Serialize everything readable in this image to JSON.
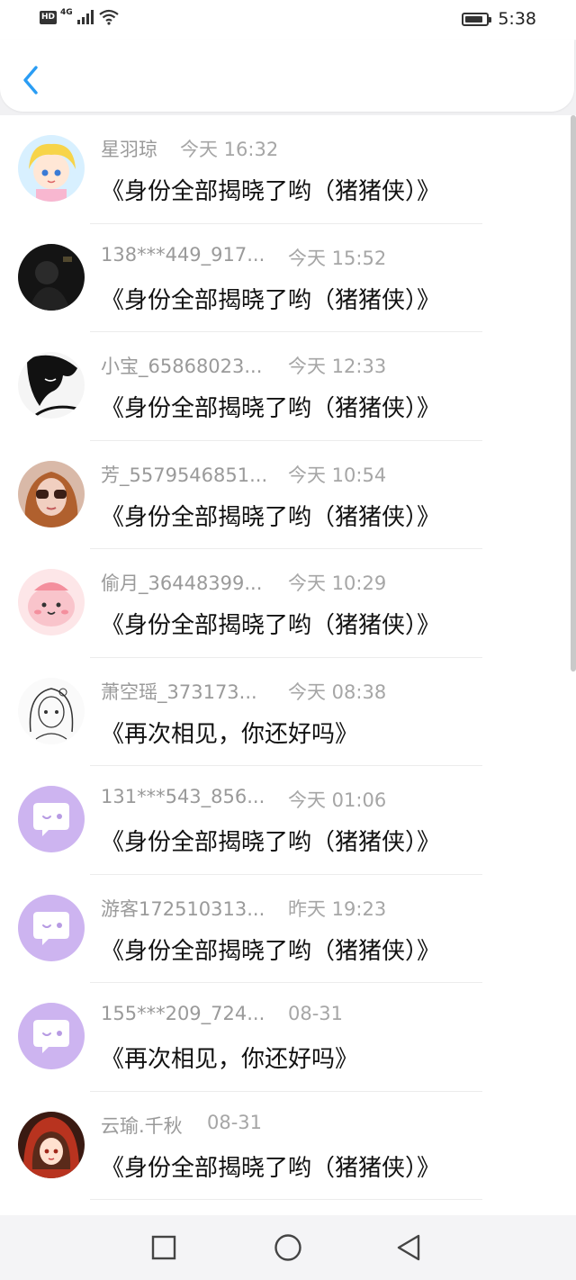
{
  "status_bar": {
    "network_badge": "HD",
    "signal_label": "4G",
    "time": "5:38",
    "battery_level": 0.85
  },
  "header": {
    "back_icon": "chevron-left-icon",
    "accent": "#2a9df4"
  },
  "messages": [
    {
      "name": "星羽琼",
      "time": "今天 16:32",
      "text": "《身份全部揭晓了哟（猪猪侠）》",
      "avatar": "anime-girl-blonde"
    },
    {
      "name": "138***449_917...",
      "time": "今天 15:52",
      "text": "《身份全部揭晓了哟（猪猪侠）》",
      "avatar": "dark-photo"
    },
    {
      "name": "小宝_65868023...",
      "time": "今天 12:33",
      "text": "《身份全部揭晓了哟（猪猪侠）》",
      "avatar": "bw-sketch"
    },
    {
      "name": "芳_5579546851...",
      "time": "今天 10:54",
      "text": "《身份全部揭晓了哟（猪猪侠）》",
      "avatar": "sunglasses-woman"
    },
    {
      "name": "偷月_36448399...",
      "time": "今天 10:29",
      "text": "《身份全部揭晓了哟（猪猪侠）》",
      "avatar": "pink-blob"
    },
    {
      "name": "萧空瑶_373173...",
      "time": "今天 08:38",
      "text": "《再次相见，你还好吗》",
      "avatar": "line-art-girl"
    },
    {
      "name": "131***543_856...",
      "time": "今天 01:06",
      "text": "《身份全部揭晓了哟（猪猪侠）》",
      "avatar": "default-chat"
    },
    {
      "name": "游客172510313...",
      "time": "昨天 19:23",
      "text": "《身份全部揭晓了哟（猪猪侠）》",
      "avatar": "default-chat"
    },
    {
      "name": "155***209_724...",
      "time": "08-31",
      "text": "《再次相见，你还好吗》",
      "avatar": "default-chat"
    },
    {
      "name": "云瑜.千秋",
      "time": "08-31",
      "text": "《身份全部揭晓了哟（猪猪侠）》",
      "avatar": "anime-red-hood"
    }
  ],
  "nav_bar": {
    "icons": [
      "square-recents-icon",
      "circle-home-icon",
      "triangle-back-icon"
    ]
  }
}
